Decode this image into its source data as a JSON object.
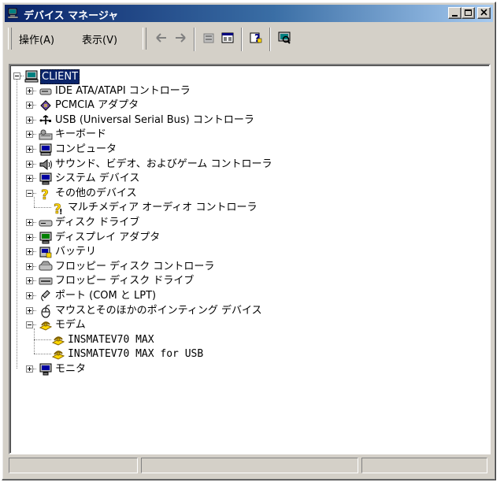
{
  "window": {
    "title": "デバイス マネージャ"
  },
  "menu": [
    {
      "label": "操作(A)"
    },
    {
      "label": "表示(V)"
    }
  ],
  "toolbar_icons": [
    "back-arrow-icon",
    "forward-arrow-icon",
    "properties-icon",
    "view-icon",
    "help-icon",
    "scan-hardware-icon"
  ],
  "tree": {
    "root": "CLIENT",
    "items": [
      {
        "label": "IDE ATA/ATAPI コントローラ",
        "icon": "ide-controller-icon",
        "expanded": false
      },
      {
        "label": "PCMCIA アダプタ",
        "icon": "pcmcia-icon",
        "expanded": false
      },
      {
        "label": "USB (Universal Serial Bus) コントローラ",
        "icon": "usb-icon",
        "expanded": false
      },
      {
        "label": "キーボード",
        "icon": "keyboard-icon",
        "expanded": false
      },
      {
        "label": "コンピュータ",
        "icon": "computer-icon",
        "expanded": false
      },
      {
        "label": "サウンド、ビデオ、およびゲーム コントローラ",
        "icon": "speaker-icon",
        "expanded": false
      },
      {
        "label": "システム デバイス",
        "icon": "system-device-icon",
        "expanded": false
      },
      {
        "label": "その他のデバイス",
        "icon": "unknown-device-icon",
        "expanded": true,
        "children": [
          {
            "label": "マルチメディア オーディオ コントローラ",
            "icon": "warning-device-icon"
          }
        ]
      },
      {
        "label": "ディスク ドライブ",
        "icon": "disk-drive-icon",
        "expanded": false
      },
      {
        "label": "ディスプレイ アダプタ",
        "icon": "display-adapter-icon",
        "expanded": false
      },
      {
        "label": "バッテリ",
        "icon": "battery-icon",
        "expanded": false
      },
      {
        "label": "フロッピー ディスク コントローラ",
        "icon": "floppy-controller-icon",
        "expanded": false
      },
      {
        "label": "フロッピー ディスク ドライブ",
        "icon": "floppy-drive-icon",
        "expanded": false
      },
      {
        "label": "ポート (COM と LPT)",
        "icon": "port-icon",
        "expanded": false
      },
      {
        "label": "マウスとそのほかのポインティング デバイス",
        "icon": "mouse-icon",
        "expanded": false
      },
      {
        "label": "モデム",
        "icon": "modem-icon",
        "expanded": true,
        "children": [
          {
            "label": "INSMATEV70 MAX",
            "icon": "modem-icon"
          },
          {
            "label": "INSMATEV70 MAX for USB",
            "icon": "modem-icon"
          }
        ]
      },
      {
        "label": "モニタ",
        "icon": "monitor-icon",
        "expanded": false
      }
    ]
  },
  "colors": {
    "selection": "#0a246a",
    "face": "#d4d0c8",
    "title_start": "#0a246a",
    "title_end": "#a6caf0"
  }
}
